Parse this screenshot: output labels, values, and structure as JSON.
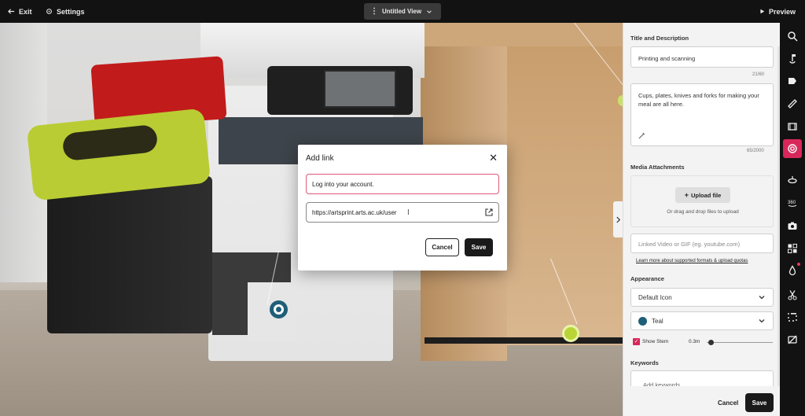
{
  "topbar": {
    "exit_label": "Exit",
    "settings_label": "Settings",
    "view_name": "Untitled View",
    "preview_label": "Preview"
  },
  "dialog": {
    "title": "Add link",
    "text_value": "Log into your account.",
    "url_value": "https://artsprint.arts.ac.uk/user",
    "cancel_label": "Cancel",
    "save_label": "Save"
  },
  "panel": {
    "title_section": "Title and Description",
    "title_value": "Printing and scanning",
    "title_counter": "21/60",
    "description_value": "Cups, plates, knives and forks for making your meal are all here.",
    "description_counter": "65/2000",
    "media_section": "Media Attachments",
    "upload_label": "Upload file",
    "upload_hint": "Or drag and drop files to upload",
    "video_placeholder": "Linked Video or GIF (eg. youtube.com)",
    "formats_link": "Learn more about supported formats & upload quotas",
    "appearance_section": "Appearance",
    "icon_select": "Default Icon",
    "color_select": "Teal",
    "show_stem_label": "Show Stem",
    "stem_value": "0.3m",
    "keywords_section": "Keywords",
    "keywords_placeholder": "Add keywords",
    "footer_cancel": "Cancel",
    "footer_save": "Save"
  },
  "colors": {
    "accent": "#d8275a",
    "teal_tag": "#1f5f78",
    "topbar_bg": "#121212",
    "panel_bg": "#f3f3f3"
  },
  "toolrail": {
    "icons": [
      "search-icon",
      "tag-pin-icon",
      "label-icon",
      "ruler-icon",
      "film-icon",
      "target-icon",
      "rotate-icon",
      "360-icon",
      "camera-icon",
      "grid-icon",
      "droplet-icon",
      "scissors-icon",
      "crop-icon",
      "hide-icon"
    ]
  }
}
